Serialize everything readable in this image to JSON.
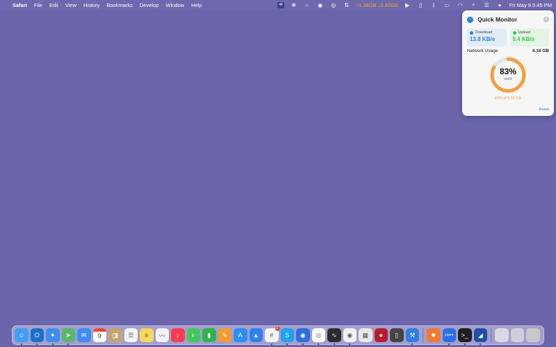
{
  "menubar": {
    "app_name": "Safari",
    "menus": [
      "File",
      "Edit",
      "View",
      "History",
      "Bookmarks",
      "Develop",
      "Window",
      "Help"
    ],
    "net_stats": "↑1.38GB ↓2.80GB",
    "clock": "Fri May 9  5:45 PM",
    "icons": [
      "apple-icon",
      "display-badge-icon",
      "snowflake-icon",
      "headphones-icon",
      "gamepad-icon",
      "eye-icon",
      "network-arrows-icon",
      "play-icon",
      "clipboard-icon",
      "bluetooth-icon",
      "battery-icon",
      "wifi-icon",
      "search-icon",
      "control-center-icon",
      "siri-icon"
    ]
  },
  "popup": {
    "title": "Quick Monitor",
    "download": {
      "label": "Download",
      "value": "13.8 KB/s"
    },
    "upload": {
      "label": "Upload",
      "value": "5.4 KB/s"
    },
    "usage_label": "Network Usage",
    "usage_total": "4.18 GB",
    "gauge_percent": "83%",
    "gauge_fraction": 0.83,
    "gauge_sub": "used",
    "usage_caption": "83% of 5.00 GB",
    "reset_label": "Reset",
    "colors": {
      "accent": "#f0a040",
      "download": "#2e7fd9",
      "upload": "#34c759"
    }
  },
  "dock": {
    "badges": {
      "slack": "1"
    },
    "calendar_day": "9",
    "calendar_month": "MAY",
    "apps": [
      {
        "name": "finder",
        "color": "#3f9ff5",
        "running": true
      },
      {
        "name": "outlook",
        "color": "#1a6fc9",
        "running": true
      },
      {
        "name": "safari",
        "color": "#3d8ef0",
        "running": true
      },
      {
        "name": "maps",
        "color": "#5ab86a",
        "running": true
      },
      {
        "name": "mail",
        "color": "#3b8ff0",
        "running": false
      },
      {
        "name": "calendar",
        "color": "#ffffff",
        "running": false
      },
      {
        "name": "contacts",
        "color": "#c8a46c",
        "running": false
      },
      {
        "name": "reminders",
        "color": "#f4f4f4",
        "running": false
      },
      {
        "name": "notes",
        "color": "#f7d75a",
        "running": false
      },
      {
        "name": "freeform",
        "color": "#f2f2f2",
        "running": false
      },
      {
        "name": "music",
        "color": "#fb3b4e",
        "running": false
      },
      {
        "name": "messages",
        "color": "#3fc95a",
        "running": false
      },
      {
        "name": "numbers",
        "color": "#2fb34c",
        "running": false
      },
      {
        "name": "pages",
        "color": "#f59b2c",
        "running": false
      },
      {
        "name": "app-store",
        "color": "#2d8ef5",
        "running": false
      },
      {
        "name": "keynote",
        "color": "#2f7ff0",
        "running": false
      },
      {
        "name": "slack",
        "color": "#f5f5f5",
        "running": true
      },
      {
        "name": "skype",
        "color": "#1ca2ee",
        "running": true
      },
      {
        "name": "location",
        "color": "#2b6fe0",
        "running": true
      },
      {
        "name": "chrome",
        "color": "#ffffff",
        "running": true
      },
      {
        "name": "activity-monitor",
        "color": "#2b2b2b",
        "running": true
      },
      {
        "name": "podcasts",
        "color": "#f2f2f2",
        "running": true
      },
      {
        "name": "launchpad",
        "color": "#e9e9e9",
        "running": false
      },
      {
        "name": "photo-booth",
        "color": "#b71d2a",
        "running": false
      },
      {
        "name": "mobile-device",
        "color": "#444444",
        "running": false
      },
      {
        "name": "xcode",
        "color": "#2f7ee8",
        "running": true
      },
      {
        "name": "burst",
        "color": "#f07a2e",
        "running": false
      },
      {
        "name": "zoom",
        "color": "#2d6fe8",
        "running": true
      },
      {
        "name": "terminal",
        "color": "#1e1e1e",
        "running": true
      },
      {
        "name": "screen-tool",
        "color": "#1f4fa8",
        "running": true
      }
    ],
    "trailing": [
      {
        "name": "downloads-stack",
        "color": "#d9d9e6"
      },
      {
        "name": "screenshots-stack",
        "color": "#d0cfd8"
      },
      {
        "name": "trash",
        "color": "#c8c8cc"
      }
    ]
  }
}
